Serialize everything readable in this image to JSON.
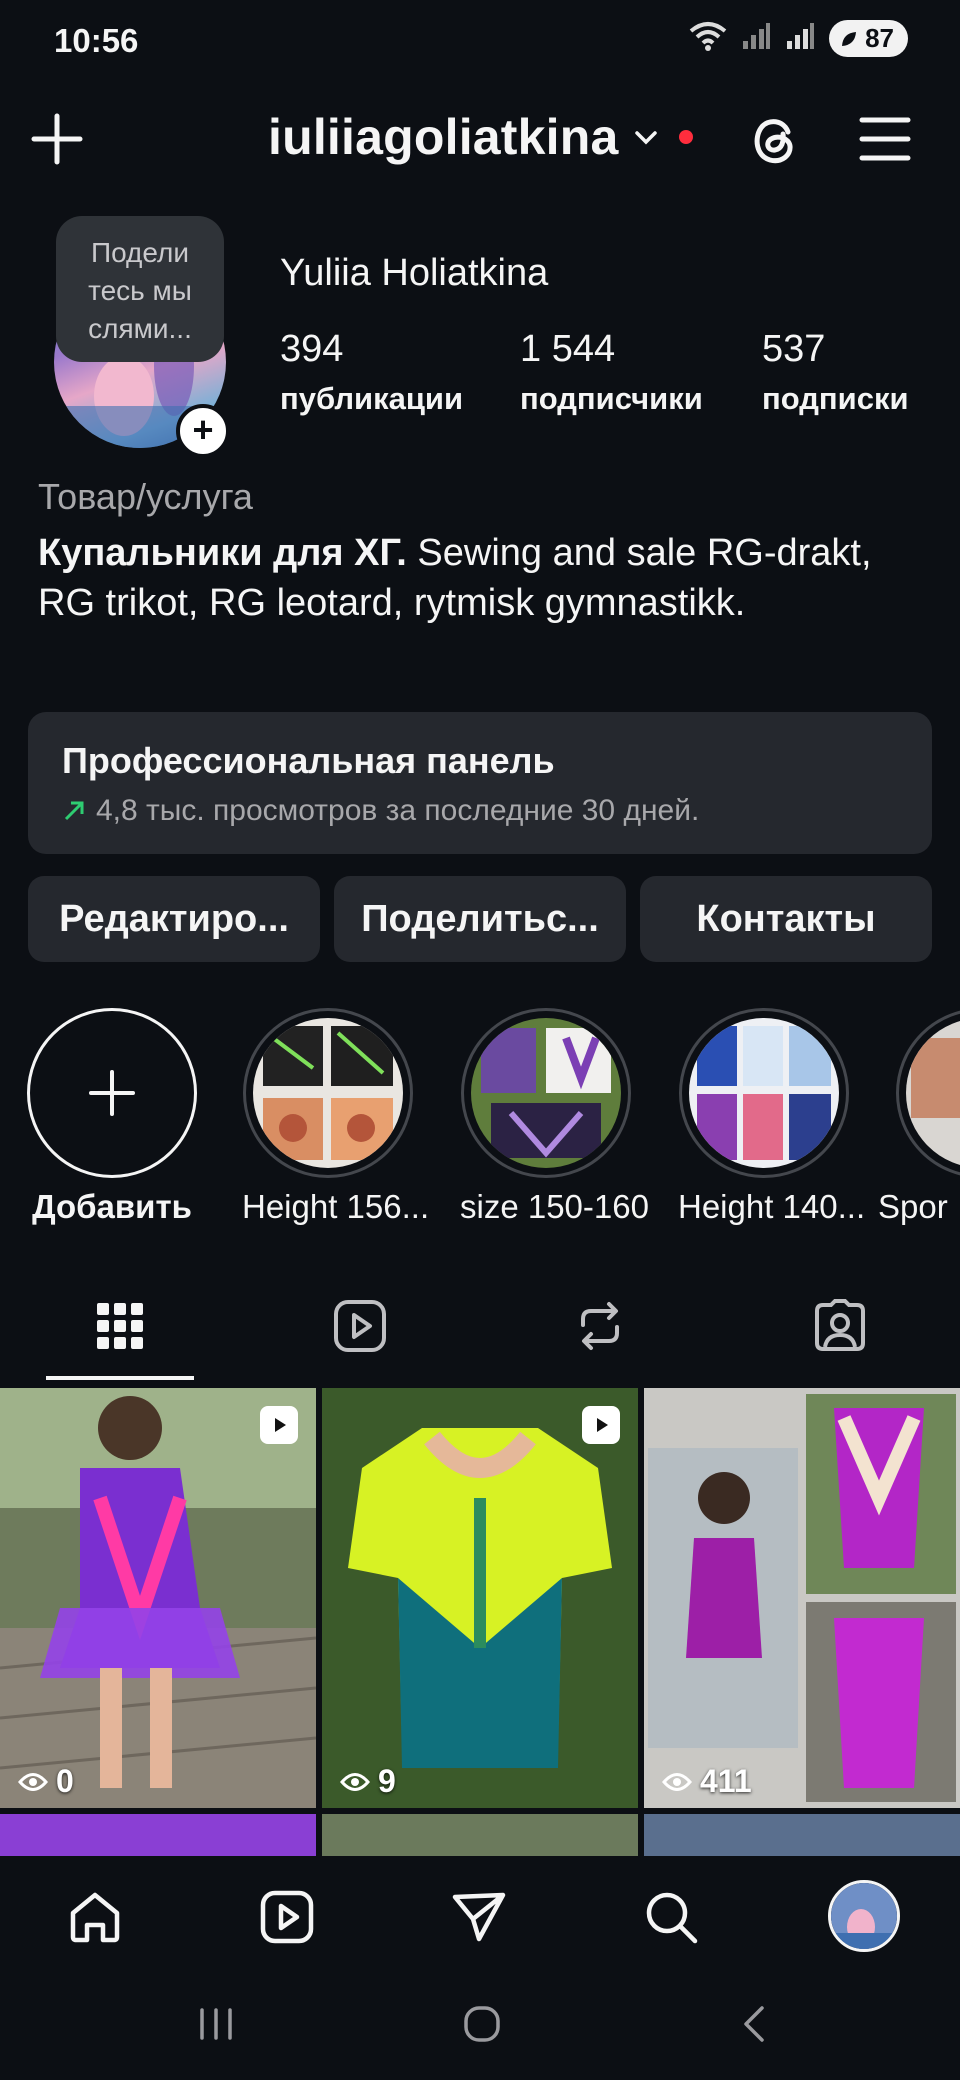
{
  "status_bar": {
    "time": "10:56",
    "battery": "87",
    "icons": [
      "wifi-icon",
      "signal-icon",
      "signal-icon",
      "battery-icon"
    ]
  },
  "header": {
    "username": "iuliiagoliatkina",
    "icons": [
      "plus-icon",
      "chevron-down-icon",
      "threads-icon",
      "menu-icon"
    ]
  },
  "profile": {
    "note": "Подели тесь мы слями...",
    "full_name": "Yuliia Holiatkina",
    "stats": [
      {
        "value": "394",
        "label": "публикации"
      },
      {
        "value": "1 544",
        "label": "подписчики"
      },
      {
        "value": "537",
        "label": "подписки"
      }
    ],
    "category": "Товар/услуга",
    "bio_bold": "Купальники для ХГ.",
    "bio_rest": " Sewing and sale RG-drakt, RG trikot, RG leotard, rytmisk gymnastikk."
  },
  "pro_panel": {
    "title": "Профессиональная панель",
    "subtitle": "4,8 тыс. просмотров за последние 30 дней."
  },
  "actions": {
    "edit": "Редактиро...",
    "share": "Поделитьс...",
    "contacts": "Контакты"
  },
  "highlights": [
    {
      "label": "Добавить"
    },
    {
      "label": "Height 156..."
    },
    {
      "label": "size 150-160"
    },
    {
      "label": "Height 140..."
    },
    {
      "label": "Spor"
    }
  ],
  "tabs": [
    "grid-icon",
    "reels-icon",
    "repost-icon",
    "tagged-icon"
  ],
  "grid": [
    {
      "views": "0",
      "reel": true
    },
    {
      "views": "9",
      "reel": true
    },
    {
      "views": "411",
      "reel": false
    }
  ],
  "bottom_nav": [
    "home-icon",
    "reels-icon",
    "messages-icon",
    "search-icon",
    "profile-avatar"
  ],
  "colors": {
    "background": "#0c0f14",
    "surface": "#25282e",
    "accent_red": "#ff2d3d",
    "trend_green": "#2ecc71"
  }
}
